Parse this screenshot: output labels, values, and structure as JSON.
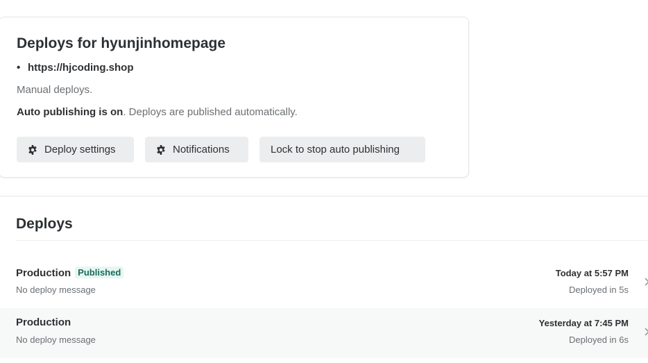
{
  "site_info": {
    "title": "Deploys for hyunjinhomepage",
    "url_bullet": "•",
    "url": "https://hjcoding.shop",
    "manual_text": "Manual deploys.",
    "auto_strong": "Auto publishing is on",
    "auto_rest": ". Deploys are published automatically."
  },
  "buttons": {
    "deploy_settings": "Deploy settings",
    "notifications": "Notifications",
    "lock": "Lock to stop auto publishing"
  },
  "icons": {
    "deploy_settings": "gear-icon",
    "notifications": "gear-icon",
    "row_chevron": "chevron-right-icon"
  },
  "deploys": {
    "title": "Deploys",
    "rows": [
      {
        "context": "Production",
        "badge": "Published",
        "message": "No deploy message",
        "time": "Today at 5:57 PM",
        "duration": "Deployed in 5s"
      },
      {
        "context": "Production",
        "badge": "",
        "message": "No deploy message",
        "time": "Yesterday at 7:45 PM",
        "duration": "Deployed in 6s"
      }
    ]
  },
  "colors": {
    "text": "#2d3033",
    "muted": "#6b6f73",
    "button_bg": "#ebedee",
    "badge_bg": "#e6f7f2",
    "badge_text": "#1b6b5b",
    "row_alt_bg": "#f7f8f8"
  }
}
